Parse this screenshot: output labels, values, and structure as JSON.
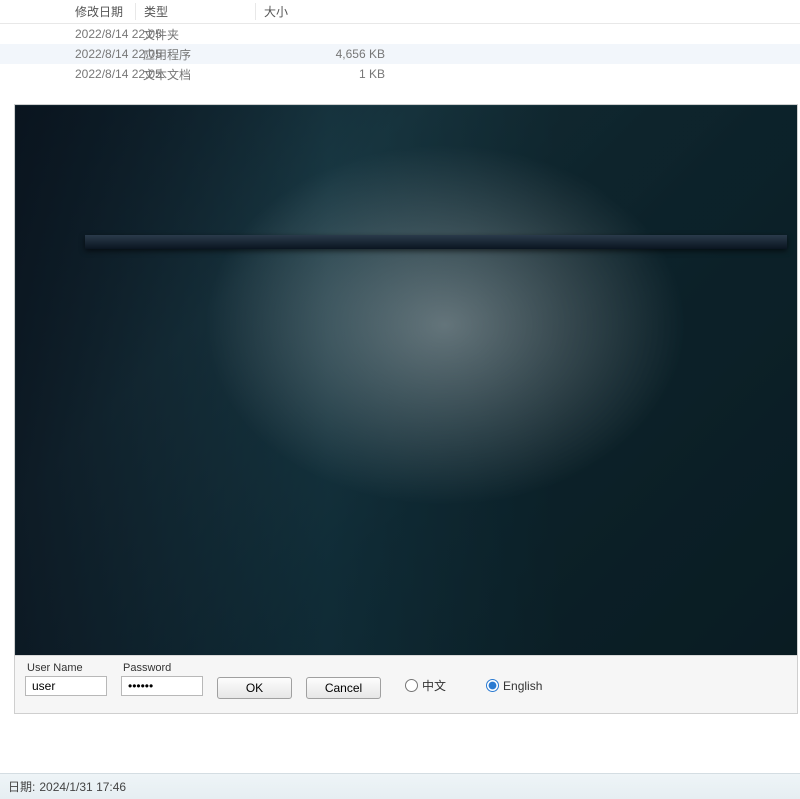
{
  "file_list": {
    "headers": {
      "date": "修改日期",
      "type": "类型",
      "size": "大小"
    },
    "rows": [
      {
        "date": "2022/8/14 22:05",
        "type": "文件夹",
        "size": ""
      },
      {
        "date": "2022/8/14 22:05",
        "type": "应用程序",
        "size": "4,656 KB",
        "selected": true
      },
      {
        "date": "2022/8/14 22:05",
        "type": "文本文档",
        "size": "1 KB"
      }
    ]
  },
  "login": {
    "username_label": "User Name",
    "username_value": "user",
    "password_label": "Password",
    "password_value": "••••••",
    "ok_label": "OK",
    "cancel_label": "Cancel",
    "lang_cn": "中文",
    "lang_en": "English",
    "lang_selected": "en"
  },
  "status": {
    "date_label": "日期:",
    "date_value": "2024/1/31 17:46"
  }
}
